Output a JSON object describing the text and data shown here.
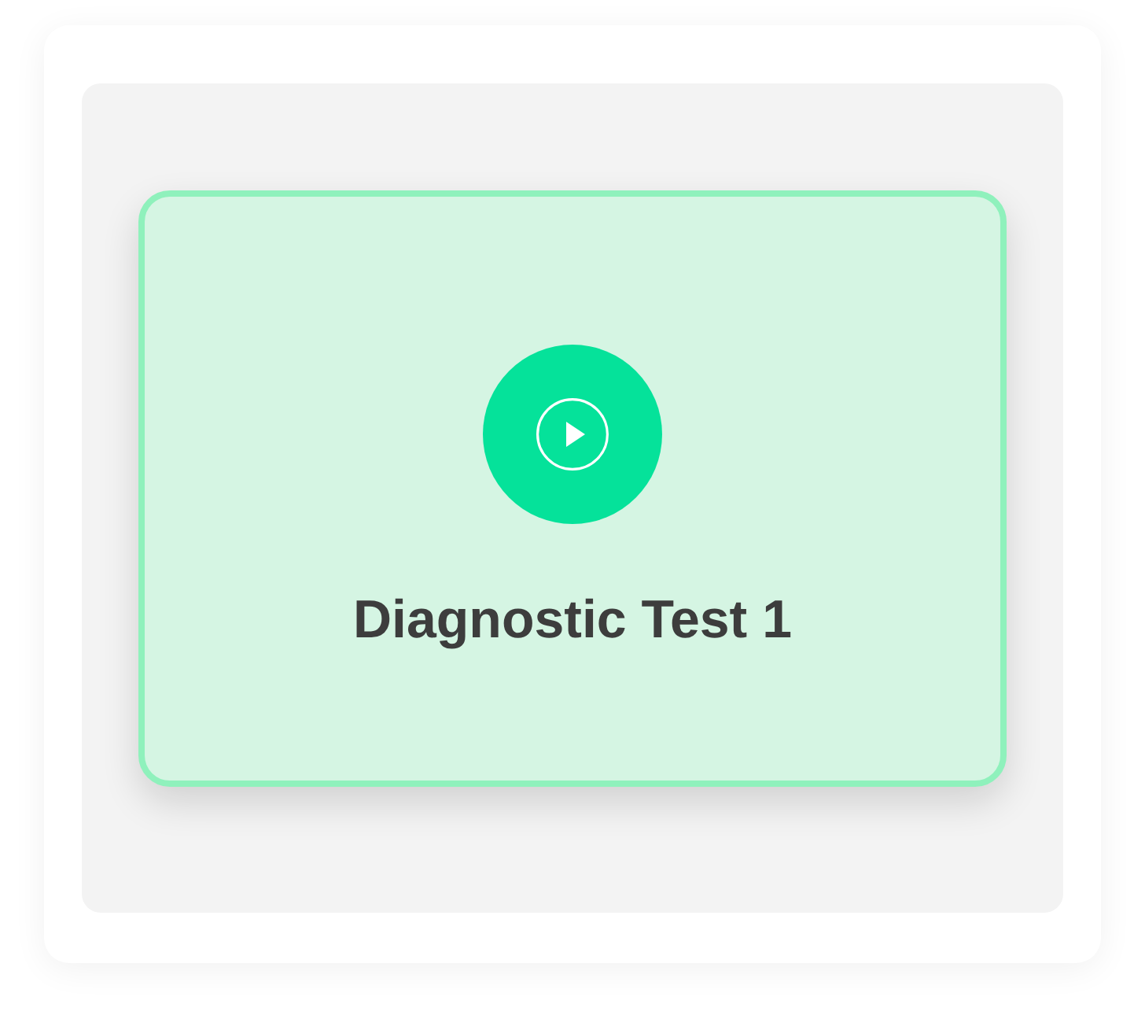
{
  "test_card": {
    "title": "Diagnostic Test 1"
  }
}
